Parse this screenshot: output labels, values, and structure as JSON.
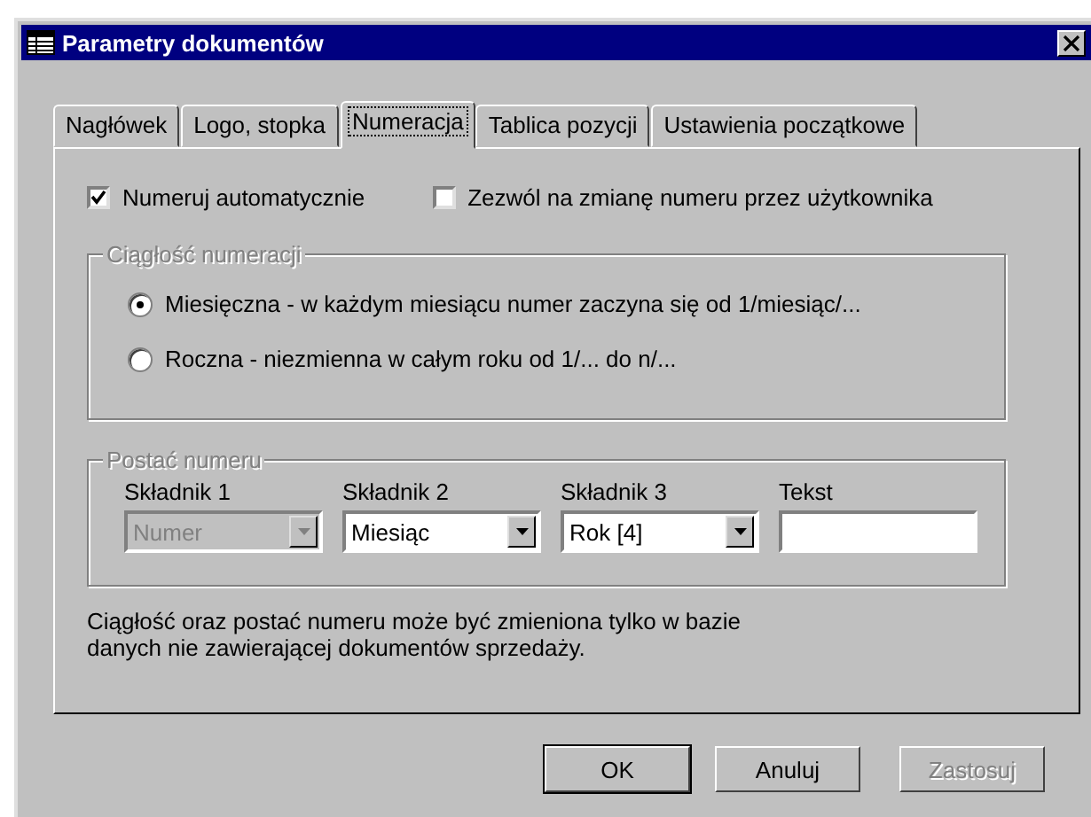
{
  "window": {
    "title": "Parametry dokumentów"
  },
  "tabs": [
    {
      "label": "Nagłówek",
      "selected": false
    },
    {
      "label": "Logo, stopka",
      "selected": false
    },
    {
      "label": "Numeracja",
      "selected": true
    },
    {
      "label": "Tablica pozycji",
      "selected": false
    },
    {
      "label": "Ustawienia początkowe",
      "selected": false
    }
  ],
  "checkboxes": [
    {
      "label": "Numeruj automatycznie",
      "checked": true
    },
    {
      "label": "Zezwól na zmianę numeru przez użytkownika",
      "checked": false
    }
  ],
  "continuity_group": {
    "legend": "Ciągłość numeracji",
    "disabled": true,
    "options": [
      {
        "label": "Miesięczna - w każdym miesiącu numer zaczyna się od 1/miesiąc/...",
        "selected": true
      },
      {
        "label": "Roczna - niezmienna w całym roku od 1/... do n/...",
        "selected": false
      }
    ]
  },
  "number_format_group": {
    "legend": "Postać numeru",
    "disabled": true,
    "components": [
      {
        "kind": "combo",
        "label": "Składnik 1",
        "value": "Numer",
        "disabled": true
      },
      {
        "kind": "combo",
        "label": "Składnik 2",
        "value": "Miesiąc",
        "disabled": false
      },
      {
        "kind": "combo",
        "label": "Składnik 3",
        "value": "Rok [4]",
        "disabled": false
      },
      {
        "kind": "text",
        "label": "Tekst"
      }
    ]
  },
  "note": "Ciągłość oraz postać numeru może być zmieniona tylko w bazie danych nie zawierającej dokumentów sprzedaży.",
  "buttons": [
    {
      "label": "OK",
      "default": true,
      "disabled": false
    },
    {
      "label": "Anuluj",
      "default": false,
      "disabled": false
    },
    {
      "label": "Zastosuj",
      "default": false,
      "disabled": true
    }
  ]
}
